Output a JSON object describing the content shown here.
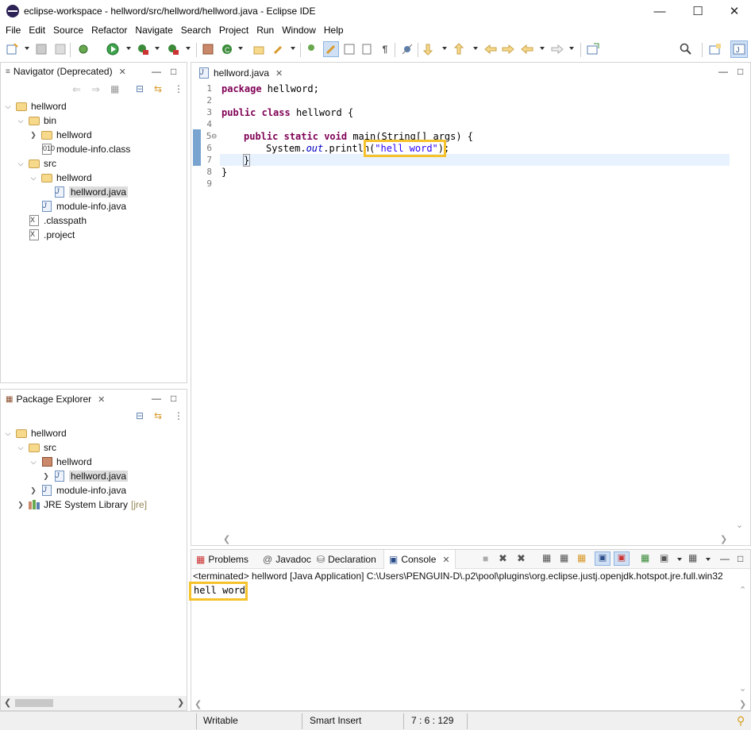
{
  "window": {
    "title": "eclipse-workspace - hellword/src/hellword/hellword.java - Eclipse IDE"
  },
  "menu": [
    "File",
    "Edit",
    "Source",
    "Refactor",
    "Navigate",
    "Search",
    "Project",
    "Run",
    "Window",
    "Help"
  ],
  "navigator": {
    "tab_label": "Navigator (Deprecated)",
    "tree": {
      "project": "hellword",
      "bin": "bin",
      "bin_pkg": "hellword",
      "module_class": "module-info.class",
      "src": "src",
      "src_pkg": "hellword",
      "hellword_java": "hellword.java",
      "module_java": "module-info.java",
      "classpath": ".classpath",
      "project_file": ".project"
    }
  },
  "package_explorer": {
    "tab_label": "Package Explorer",
    "tree": {
      "project": "hellword",
      "src": "src",
      "pkg": "hellword",
      "hellword_java": "hellword.java",
      "module_java": "module-info.java",
      "jre": "JRE System Library",
      "jre_suffix": "[jre]"
    }
  },
  "editor": {
    "tab_label": "hellword.java",
    "line_numbers": [
      "1",
      "2",
      "3",
      "4",
      "5⊖",
      "6",
      "7",
      "8",
      "9"
    ],
    "code": {
      "line1_kw": "package",
      "line1_rest": " hellword;",
      "line3_kw1": "public",
      "line3_kw2": "class",
      "line3_rest": " hellword {",
      "line5_kw1": "public",
      "line5_kw2": "static",
      "line5_kw3": "void",
      "line5_rest": " main(String[] args) {",
      "line6_pre": "System.",
      "line6_field": "out",
      "line6_mid": ".println(",
      "line6_str": "\"hell word\"",
      "line6_post": ");",
      "line7": "}",
      "line8": "}"
    }
  },
  "console_view": {
    "tabs": [
      "Problems",
      "Javadoc",
      "Declaration",
      "Console"
    ],
    "terminated_line": "<terminated> hellword [Java Application] C:\\Users\\PENGUIN-D\\.p2\\pool\\plugins\\org.eclipse.justj.openjdk.hotspot.jre.full.win32",
    "output": "hell word"
  },
  "status": {
    "writable": "Writable",
    "insert_mode": "Smart Insert",
    "position": "7 : 6 : 129"
  },
  "colors": {
    "highlight": "#f5c22b",
    "keyword": "#7f0055",
    "string": "#2a00ff",
    "current_line": "#e8f2fe"
  }
}
